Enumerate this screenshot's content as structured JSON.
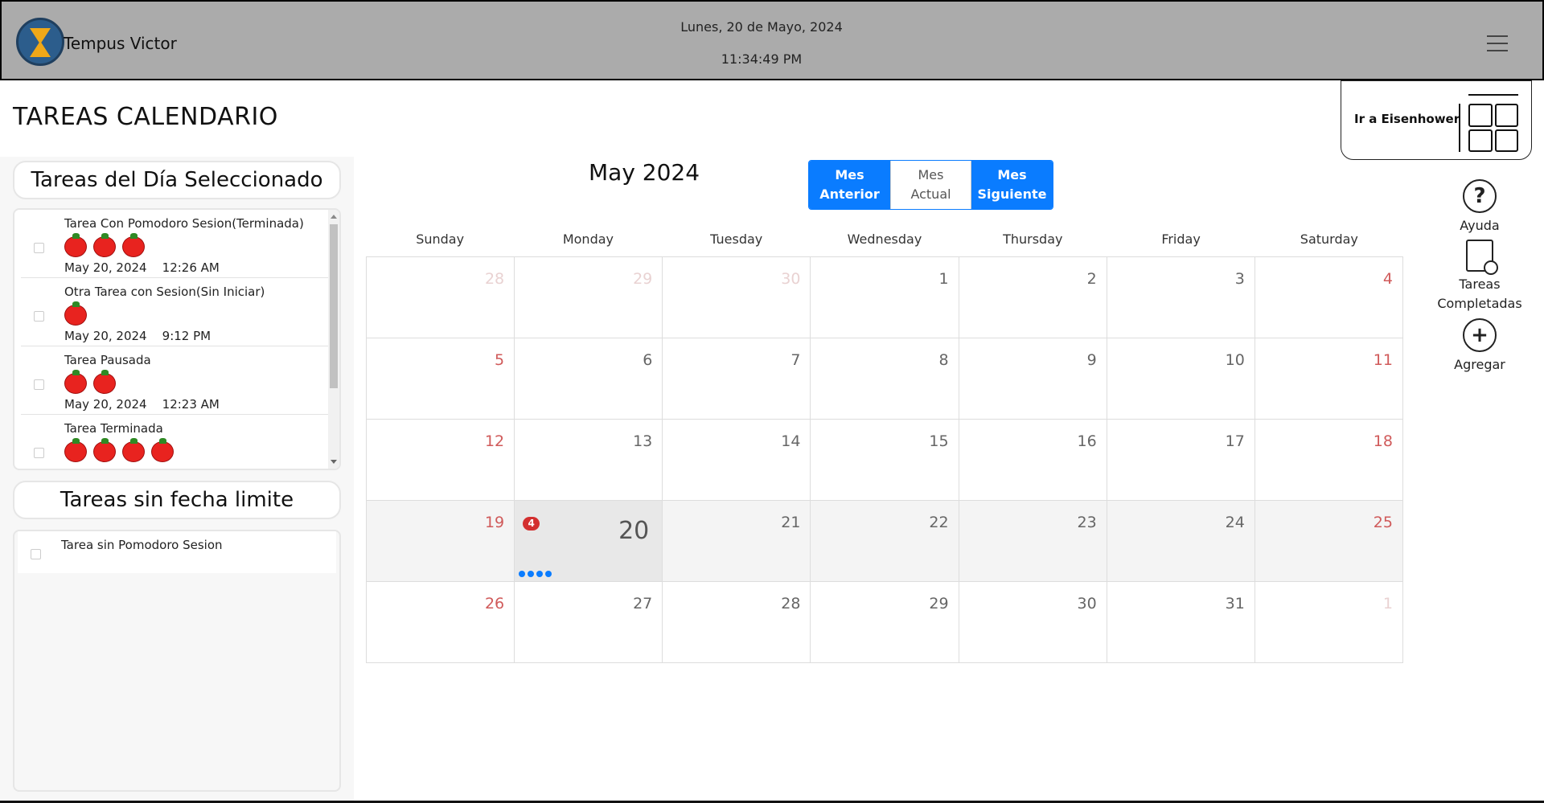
{
  "header": {
    "app_name": "Tempus Victor",
    "date": "Lunes, 20 de Mayo, 2024",
    "time": "11:34:49 PM",
    "menu_icon": "hamburger-menu-icon"
  },
  "page_title": "TAREAS CALENDARIO",
  "eisenhower_button": {
    "label": "Ir a Eisenhower",
    "icon": "matrix-grid-icon"
  },
  "selected_day_section": {
    "title": "Tareas del Día Seleccionado",
    "tasks": [
      {
        "name": "Tarea Con Pomodoro Sesion(Terminada)",
        "pomodoros": 3,
        "date": "May 20, 2024    12:26 AM"
      },
      {
        "name": "Otra Tarea con Sesion(Sin Iniciar)",
        "pomodoros": 1,
        "date": "May 20, 2024    9:12 PM"
      },
      {
        "name": "Tarea Pausada",
        "pomodoros": 2,
        "date": "May 20, 2024    12:23 AM"
      },
      {
        "name": "Tarea Terminada",
        "pomodoros": 4,
        "date": ""
      }
    ]
  },
  "no_date_section": {
    "title": "Tareas sin fecha limite",
    "tasks": [
      {
        "name": "Tarea sin Pomodoro Sesion"
      }
    ]
  },
  "calendar": {
    "month_label": "May 2024",
    "nav": {
      "prev_line1": "Mes",
      "prev_line2": "Anterior",
      "current_line1": "Mes",
      "current_line2": "Actual",
      "next_line1": "Mes",
      "next_line2": "Siguiente"
    },
    "weekdays": [
      "Sunday",
      "Monday",
      "Tuesday",
      "Wednesday",
      "Thursday",
      "Friday",
      "Saturday"
    ],
    "days": [
      {
        "n": "28",
        "other": true
      },
      {
        "n": "29",
        "other": true
      },
      {
        "n": "30",
        "other": true
      },
      {
        "n": "1"
      },
      {
        "n": "2"
      },
      {
        "n": "3"
      },
      {
        "n": "4"
      },
      {
        "n": "5"
      },
      {
        "n": "6"
      },
      {
        "n": "7"
      },
      {
        "n": "8"
      },
      {
        "n": "9"
      },
      {
        "n": "10"
      },
      {
        "n": "11"
      },
      {
        "n": "12"
      },
      {
        "n": "13"
      },
      {
        "n": "14"
      },
      {
        "n": "15"
      },
      {
        "n": "16"
      },
      {
        "n": "17"
      },
      {
        "n": "18"
      },
      {
        "n": "19"
      },
      {
        "n": "20",
        "selected": true,
        "badge": "4",
        "dots": 4
      },
      {
        "n": "21"
      },
      {
        "n": "22"
      },
      {
        "n": "23"
      },
      {
        "n": "24"
      },
      {
        "n": "25"
      },
      {
        "n": "26"
      },
      {
        "n": "27"
      },
      {
        "n": "28"
      },
      {
        "n": "29"
      },
      {
        "n": "30"
      },
      {
        "n": "31"
      },
      {
        "n": "1",
        "other": true
      }
    ],
    "highlight_week_row": 3
  },
  "right_rail": {
    "help_label": "Ayuda",
    "completed_line1": "Tareas",
    "completed_line2": "Completadas",
    "add_label": "Agregar"
  },
  "colors": {
    "header_bg": "#ababab",
    "accent_blue": "#0a7cff",
    "weekend_red": "#d05a5a",
    "badge_red": "#d32f2f",
    "tomato_red": "#e8231f"
  }
}
